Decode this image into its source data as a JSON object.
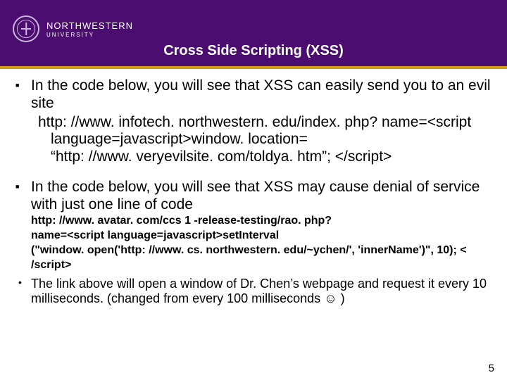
{
  "header": {
    "brand_top": "NORTHWESTERN",
    "brand_bottom": "UNIVERSITY",
    "title": "Cross Side Scripting (XSS)"
  },
  "bullets": {
    "b1": {
      "lead": "In the code below, you will see that XSS can easily send you to an evil site",
      "line1": "http: //www. infotech. northwestern. edu/index. php? name=<script",
      "line2": "language=javascript>window. location=",
      "line3": "“http: //www. veryevilsite. com/toldya. htm”; </script>"
    },
    "b2": {
      "lead": "In the code below, you will see that XSS may cause denial of service with just one line of code",
      "line1": "http: //www. avatar. com/ccs 1 -release-testing/rao. php?",
      "line2": "name=<script language=javascript>setInterval",
      "line3": "(\"window. open('http: //www. cs. northwestern. edu/~ychen/', 'innerName')\", 10); <",
      "line4": "/script>"
    },
    "b3": {
      "text_a": "The link above will open a window of Dr. Chen’s webpage and request it every 10 milliseconds.  (changed from every 100 milliseconds ",
      "smiley": "☺",
      "text_b": " )"
    }
  },
  "page_number": "5"
}
